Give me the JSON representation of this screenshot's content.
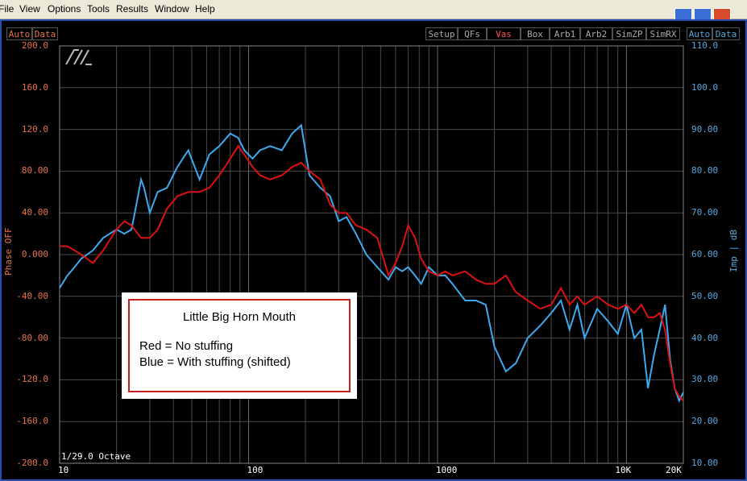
{
  "menu": [
    "File",
    "View",
    "Options",
    "Tools",
    "Results",
    "Window",
    "Help"
  ],
  "toolbar_left": [
    "Auto",
    "Data"
  ],
  "toolbar_right": [
    "Setup",
    "QFs",
    "Vas",
    "Box",
    "Arb1",
    "Arb2",
    "SimZP",
    "SimRX"
  ],
  "toolbar_far_right": [
    "Auto",
    "Data"
  ],
  "active_tab": "Vas",
  "octave_label": "1/29.0 Octave",
  "legend": {
    "title": "Little Big Horn Mouth",
    "line1": "Red = No stuffing",
    "line2": "Blue = With stuffing (shifted)"
  },
  "colors": {
    "red_series": "#dd1111",
    "blue_series": "#3fa9f0",
    "left_axis": "#e8734a",
    "right_axis": "#5aa8e0",
    "grid": "#4a4a4a",
    "frame": "#2a4db0"
  },
  "chart_data": {
    "type": "line",
    "x_scale": "log",
    "xlim": [
      10,
      20000
    ],
    "x_tick_labels": [
      "10",
      "100",
      "1000",
      "10K",
      "20K"
    ],
    "y_left": {
      "label": "Phase OFF",
      "ylim": [
        -200,
        200
      ],
      "ticks": [
        "200.0",
        "160.0",
        "120.0",
        "80.00",
        "40.00",
        "0.000",
        "-40.00",
        "-80.00",
        "-120.0",
        "-160.0",
        "-200.0"
      ]
    },
    "y_right": {
      "label": "Imp | dB",
      "ylim": [
        10,
        110
      ],
      "ticks": [
        "110.0",
        "100.0",
        "90.00",
        "80.00",
        "70.00",
        "60.00",
        "50.00",
        "40.00",
        "30.00",
        "20.00",
        "10.00"
      ]
    },
    "grid": true,
    "series": [
      {
        "color": "red",
        "x": [
          10,
          11,
          12,
          13,
          15,
          17,
          20,
          22,
          24,
          27,
          30,
          33,
          37,
          42,
          48,
          55,
          62,
          70,
          80,
          88,
          95,
          105,
          115,
          130,
          150,
          170,
          190,
          210,
          240,
          270,
          300,
          330,
          370,
          420,
          480,
          550,
          600,
          650,
          700,
          760,
          820,
          900,
          1000,
          1100,
          1200,
          1400,
          1600,
          1800,
          2000,
          2300,
          2600,
          3000,
          3500,
          4000,
          4500,
          5000,
          5500,
          6000,
          7000,
          8000,
          9000,
          10000,
          11000,
          12000,
          13000,
          14000,
          15000,
          16000,
          17000,
          18000,
          19000,
          20000
        ],
        "y": [
          62,
          62,
          61,
          60,
          58,
          61,
          66,
          68,
          67,
          64,
          64,
          66,
          71,
          74,
          75,
          75,
          76,
          79,
          83,
          86,
          84,
          81,
          79,
          78,
          79,
          81,
          82,
          80,
          78,
          72,
          70,
          70,
          67,
          66,
          64,
          55,
          58,
          62,
          67,
          64,
          59,
          56,
          55,
          56,
          55,
          56,
          54,
          53,
          53,
          55,
          51,
          49,
          47,
          48,
          52,
          48,
          50,
          48,
          50,
          48,
          47,
          48,
          46,
          48,
          45,
          45,
          46,
          42,
          34,
          28,
          26,
          25
        ]
      },
      {
        "color": "blue",
        "x": [
          10,
          11,
          12,
          13,
          15,
          17,
          20,
          22,
          24,
          25,
          27,
          28,
          30,
          33,
          37,
          42,
          48,
          55,
          62,
          70,
          80,
          88,
          95,
          105,
          115,
          130,
          150,
          170,
          190,
          210,
          240,
          270,
          300,
          330,
          370,
          420,
          480,
          550,
          600,
          650,
          700,
          760,
          820,
          900,
          1000,
          1100,
          1200,
          1400,
          1600,
          1800,
          2000,
          2300,
          2600,
          3000,
          3500,
          4000,
          4500,
          5000,
          5500,
          6000,
          7000,
          8000,
          9000,
          10000,
          11000,
          12000,
          13000,
          14000,
          15000,
          16000,
          17000,
          18000,
          19000,
          20000
        ],
        "y": [
          52,
          55,
          57,
          59,
          61,
          64,
          66,
          65,
          66,
          70,
          78,
          76,
          70,
          75,
          76,
          81,
          85,
          78,
          84,
          86,
          89,
          88,
          85,
          83,
          85,
          86,
          85,
          89,
          91,
          79,
          76,
          74,
          68,
          69,
          65,
          60,
          57,
          54,
          57,
          56,
          57,
          55,
          53,
          57,
          55,
          55,
          53,
          49,
          49,
          48,
          38,
          32,
          34,
          40,
          43,
          46,
          49,
          42,
          48,
          40,
          47,
          44,
          41,
          48,
          40,
          42,
          28,
          36,
          42,
          48,
          35,
          28,
          25,
          27
        ]
      }
    ]
  }
}
